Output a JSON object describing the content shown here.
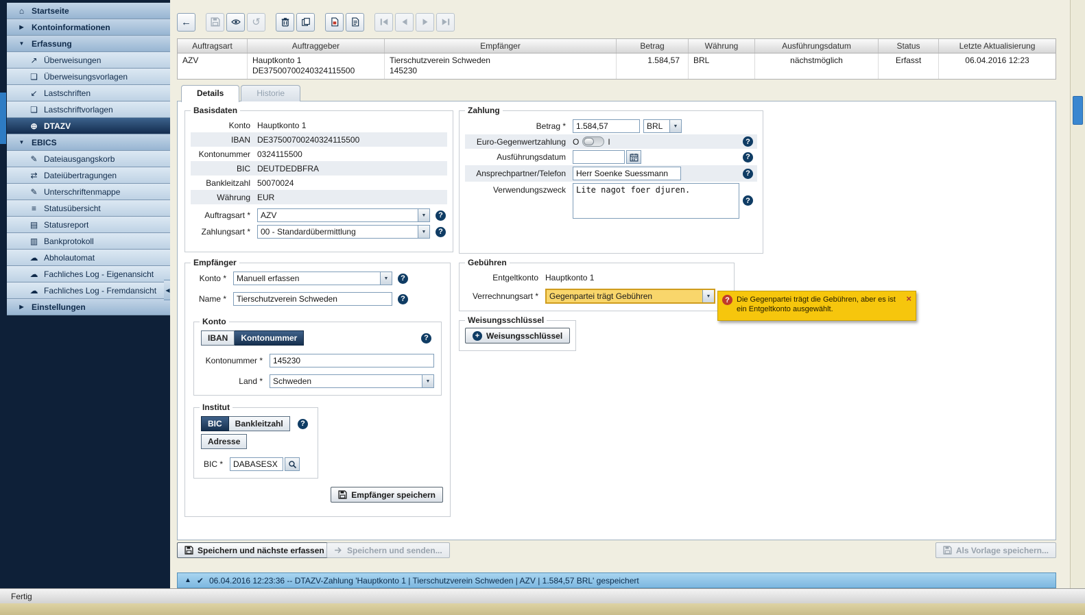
{
  "icons": {
    "help": "?",
    "dropdown": "▼",
    "back": "←",
    "undo": "↺",
    "collapse_sidebar": "◀",
    "plus": "+",
    "close": "×",
    "check": "✔",
    "collapse_up": "▲",
    "warning": "?"
  },
  "sidebar": {
    "items": [
      {
        "label": "Startseite",
        "glyph": "⌂"
      },
      {
        "label": "Kontoinformationen",
        "glyph": "▶"
      },
      {
        "label": "Erfassung",
        "glyph": "▼"
      },
      {
        "label": "Überweisungen",
        "glyph": "↗"
      },
      {
        "label": "Überweisungsvorlagen",
        "glyph": "❏"
      },
      {
        "label": "Lastschriften",
        "glyph": "↙"
      },
      {
        "label": "Lastschriftvorlagen",
        "glyph": "❏"
      },
      {
        "label": "DTAZV",
        "glyph": "⊕"
      },
      {
        "label": "EBICS",
        "glyph": "▼"
      },
      {
        "label": "Dateiausgangskorb",
        "glyph": "✎"
      },
      {
        "label": "Dateiübertragungen",
        "glyph": "⇄"
      },
      {
        "label": "Unterschriftenmappe",
        "glyph": "✎"
      },
      {
        "label": "Statusübersicht",
        "glyph": "≡"
      },
      {
        "label": "Statusreport",
        "glyph": "▤"
      },
      {
        "label": "Bankprotokoll",
        "glyph": "▥"
      },
      {
        "label": "Abholautomat",
        "glyph": "☁"
      },
      {
        "label": "Fachliches Log - Eigenansicht",
        "glyph": "☁"
      },
      {
        "label": "Fachliches Log - Fremdansicht",
        "glyph": "☁"
      },
      {
        "label": "Einstellungen",
        "glyph": "▶"
      }
    ]
  },
  "table": {
    "columns": [
      "Auftragsart",
      "Auftraggeber",
      "Empfänger",
      "Betrag",
      "Währung",
      "Ausführungsdatum",
      "Status",
      "Letzte Aktualisierung"
    ],
    "row": {
      "auftragsart": "AZV",
      "auftraggeber_1": "Hauptkonto 1",
      "auftraggeber_2": "DE37500700240324115500",
      "empfaenger_1": "Tierschutzverein Schweden",
      "empfaenger_2": "145230",
      "betrag": "1.584,57",
      "waehrung": "BRL",
      "ausfuehrungsdatum": "nächstmöglich",
      "status": "Erfasst",
      "letzte_aktualisierung": "06.04.2016 12:23"
    }
  },
  "tabs": {
    "details": "Details",
    "historie": "Historie"
  },
  "basisdaten": {
    "legend": "Basisdaten",
    "rows": [
      {
        "label": "Konto",
        "value": "Hauptkonto 1"
      },
      {
        "label": "IBAN",
        "value": "DE37500700240324115500"
      },
      {
        "label": "Kontonummer",
        "value": "0324115500"
      },
      {
        "label": "BIC",
        "value": "DEUTDEDBFRA"
      },
      {
        "label": "Bankleitzahl",
        "value": "50070024"
      },
      {
        "label": "Währung",
        "value": "EUR"
      }
    ],
    "auftragsart_label": "Auftragsart *",
    "auftragsart_value": "AZV",
    "zahlungsart_label": "Zahlungsart *",
    "zahlungsart_value": "00 - Standardübermittlung"
  },
  "empfaenger": {
    "legend": "Empfänger",
    "konto_label": "Konto *",
    "konto_value": "Manuell erfassen",
    "name_label": "Name *",
    "name_value": "Tierschutzverein Schweden",
    "konto_fieldset": {
      "legend": "Konto",
      "toggle_iban": "IBAN",
      "toggle_kontonummer": "Kontonummer",
      "kontonummer_label": "Kontonummer *",
      "kontonummer_value": "145230",
      "land_label": "Land *",
      "land_value": "Schweden"
    },
    "institut_fieldset": {
      "legend": "Institut",
      "toggle_bic": "BIC",
      "toggle_bankleitzahl": "Bankleitzahl",
      "toggle_adresse": "Adresse",
      "bic_label": "BIC *",
      "bic_value": "DABASESX"
    },
    "save_button": "Empfänger speichern"
  },
  "zahlung": {
    "legend": "Zahlung",
    "betrag_label": "Betrag *",
    "betrag_value": "1.584,57",
    "currency_value": "BRL",
    "euro_label": "Euro-Gegenwertzahlung",
    "toggle_off": "O",
    "toggle_on": "I",
    "ausfuehrungsdatum_label": "Ausführungsdatum",
    "ausfuehrungsdatum_value": "",
    "ansprechpartner_label": "Ansprechpartner/Telefon",
    "ansprechpartner_value": "Herr Soenke Suessmann",
    "verwendungszweck_label": "Verwendungszweck",
    "verwendungszweck_value": "Lite nagot foer djuren."
  },
  "gebuehren": {
    "legend": "Gebühren",
    "entgeltkonto_label": "Entgeltkonto",
    "entgeltkonto_value": "Hauptkonto 1",
    "verrechnungsart_label": "Verrechnungsart *",
    "verrechnungsart_value": "Gegenpartei trägt Gebühren",
    "warning_text": "Die Gegenpartei trägt die Gebühren, aber es ist ein Entgeltkonto ausgewählt."
  },
  "weisungsschluessel": {
    "legend": "Weisungsschlüssel",
    "button": "Weisungsschlüssel"
  },
  "footer": {
    "save_next": "Speichern und nächste erfassen",
    "save_send": "Speichern und senden...",
    "save_template": "Als Vorlage speichern..."
  },
  "statusmessage": "06.04.2016 12:23:36 -- DTAZV-Zahlung 'Hauptkonto 1 | Tierschutzverein Schweden | AZV | 1.584,57 BRL' gespeichert",
  "window": {
    "status": "Fertig"
  }
}
